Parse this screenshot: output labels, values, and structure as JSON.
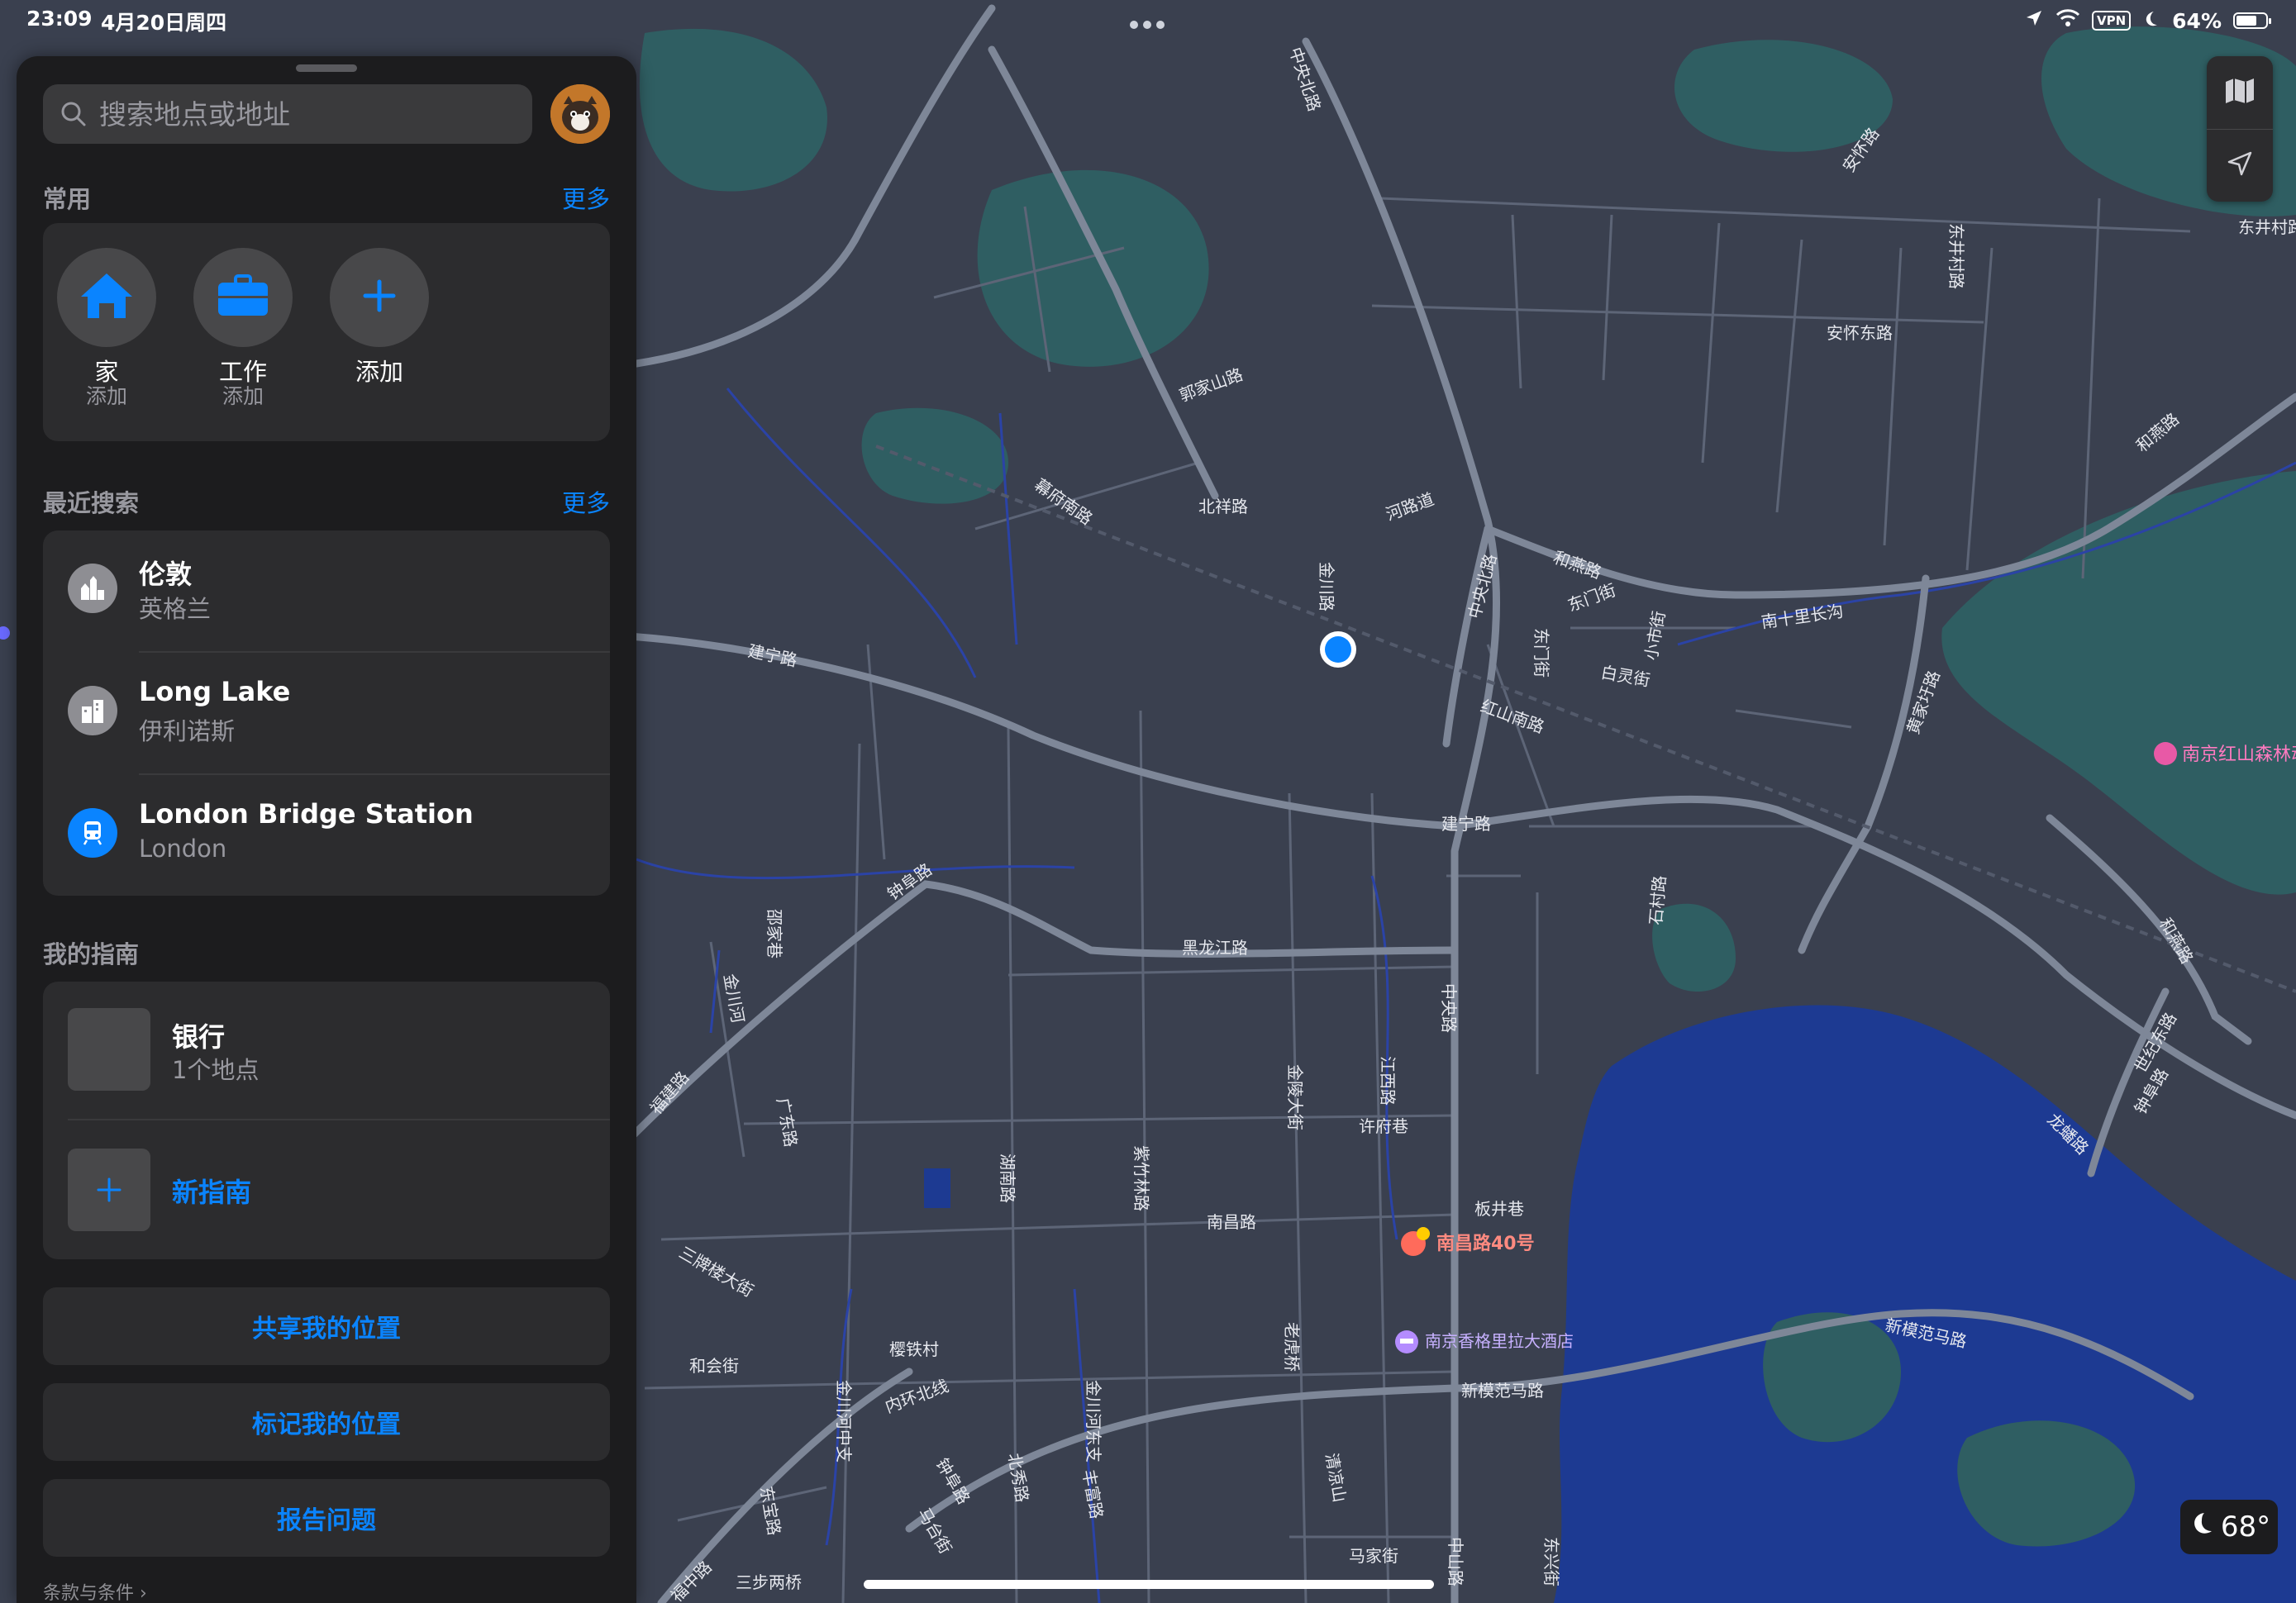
{
  "status_bar": {
    "time": "23:09",
    "date": "4月20日周四",
    "vpn": "VPN",
    "battery": "64%",
    "battery_level": 0.64
  },
  "search": {
    "placeholder": "搜索地点或地址"
  },
  "favorites": {
    "title": "常用",
    "more": "更多",
    "items": [
      {
        "label": "家",
        "sub": "添加",
        "icon": "house-icon"
      },
      {
        "label": "工作",
        "sub": "添加",
        "icon": "briefcase-icon"
      },
      {
        "label": "添加",
        "sub": "",
        "icon": "plus-icon"
      }
    ]
  },
  "recents": {
    "title": "最近搜索",
    "more": "更多",
    "items": [
      {
        "title": "伦敦",
        "sub": "英格兰",
        "icon": "city-icon"
      },
      {
        "title": "Long Lake",
        "sub": "伊利诺斯",
        "icon": "building-icon"
      },
      {
        "title": "London Bridge Station",
        "sub": "London",
        "icon": "train-icon"
      }
    ]
  },
  "guides": {
    "title": "我的指南",
    "items": [
      {
        "title": "银行",
        "sub": "1个地点"
      }
    ],
    "new_label": "新指南"
  },
  "actions": {
    "share": "共享我的位置",
    "mark": "标记我的位置",
    "report": "报告问题"
  },
  "terms": "条款与条件 ›",
  "weather": {
    "temp": "68°"
  },
  "map": {
    "roads": [
      "中央北路",
      "安怀路",
      "安怀东路",
      "东井村路",
      "郭家山路",
      "幕府南路",
      "北祥路",
      "河路道",
      "金川路",
      "和燕路",
      "中央北路",
      "东门街",
      "东门街",
      "白灵街",
      "小市街",
      "南十里长沟",
      "建宁路",
      "红山南路",
      "建宁路",
      "黄家圩路",
      "钟阜路",
      "黑龙江路",
      "中央路",
      "金川河",
      "石村路",
      "东井村路",
      "福建路",
      "广东路",
      "三牌楼大街",
      "和会街",
      "南昌路",
      "许府巷",
      "江西路",
      "金陵大街",
      "板井巷",
      "南京香格里拉大酒店",
      "新模范马路",
      "新模范马路",
      "内环北线",
      "樱铁村",
      "紫竹林路",
      "钟阜路",
      "湖南路",
      "清凉山",
      "中山路",
      "马家街",
      "东兴街",
      "北秀路",
      "龙蟠路",
      "世纪东路",
      "三步两桥",
      "福中路",
      "东宝路",
      "金川河东支",
      "金川河中支",
      "马台街",
      "邵家巷",
      "丰富路",
      "老虎桥",
      "和燕路",
      "和燕路",
      "钟阜路"
    ],
    "pois": [
      "南京红山森林动物园",
      "南昌路40号",
      "南京香格里拉大酒店"
    ]
  }
}
